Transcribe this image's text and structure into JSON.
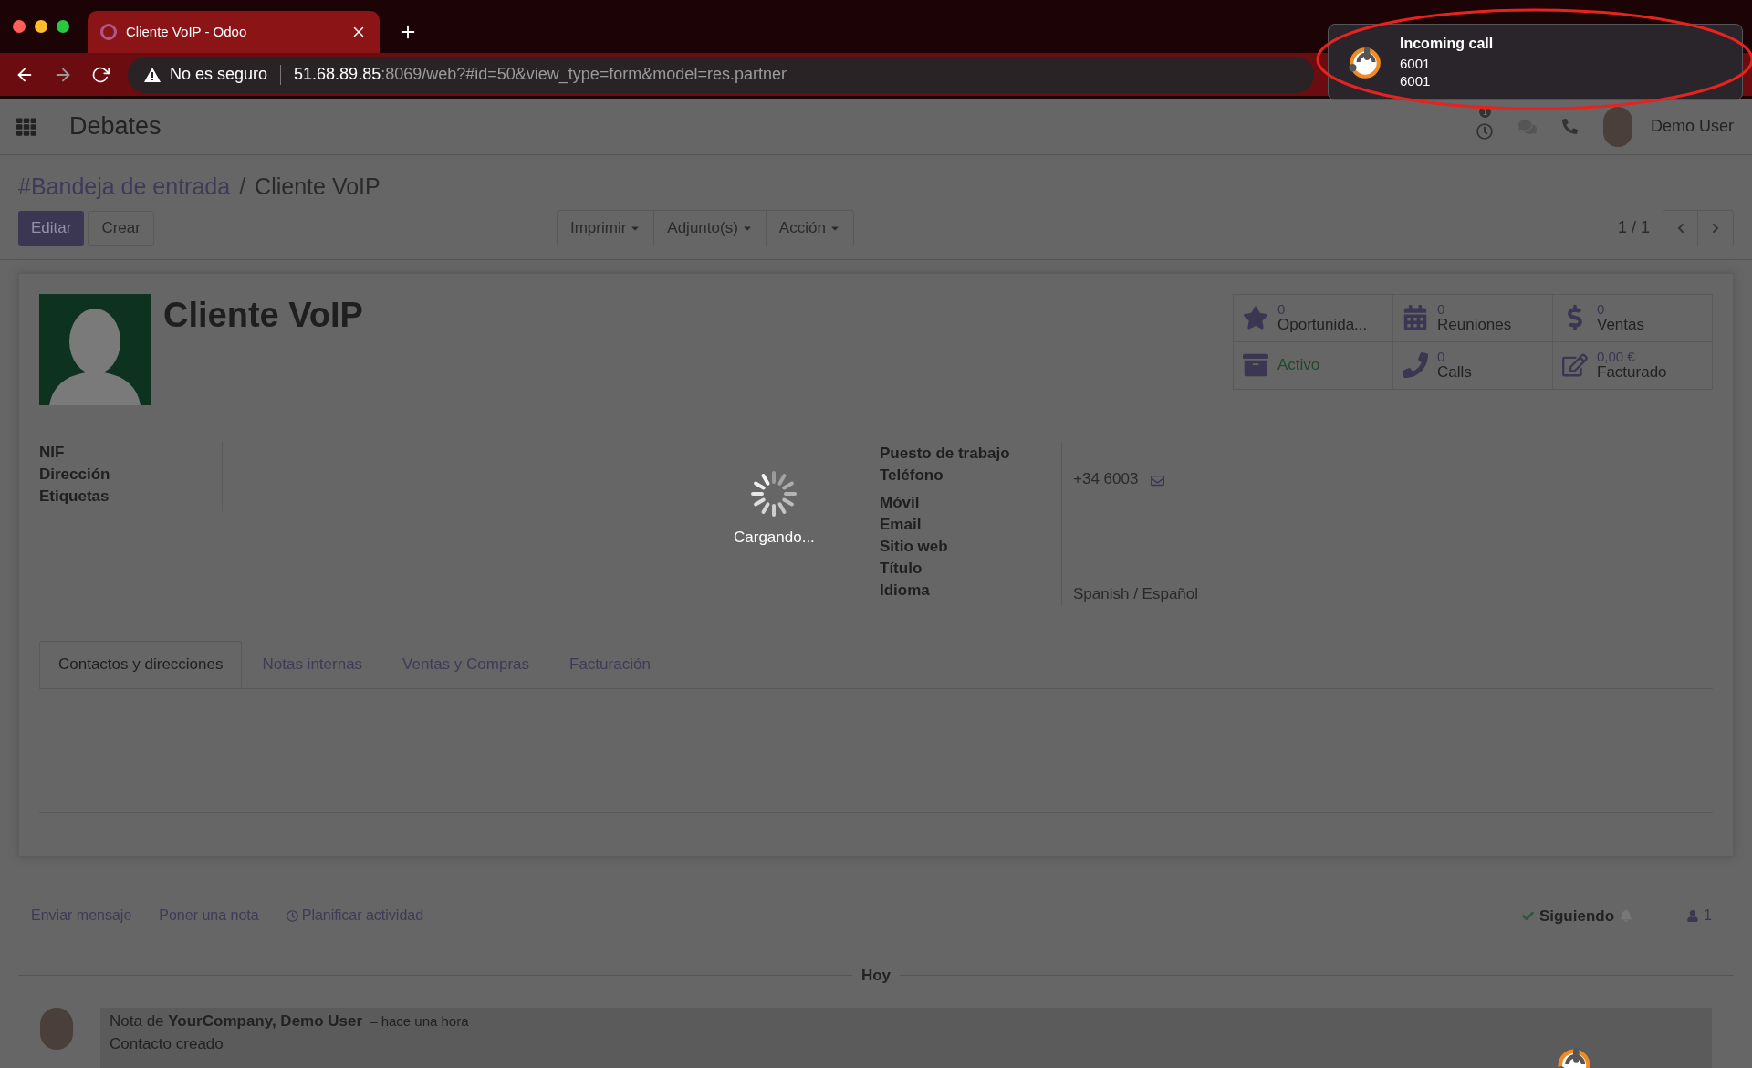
{
  "browser": {
    "tab_title": "Cliente VoIP - Odoo",
    "warning": "No es seguro",
    "host": "51.68.89.85",
    "path": ":8069/web?#id=50&view_type=form&model=res.partner"
  },
  "notification": {
    "title": "Incoming call",
    "lines": [
      "6001",
      "6001"
    ]
  },
  "navbar": {
    "app": "Debates",
    "activity_count": "1",
    "user": "Demo User"
  },
  "breadcrumb": [
    {
      "label": "#Bandeja de entrada",
      "link": true
    },
    {
      "label": "Cliente VoIP",
      "link": false
    }
  ],
  "breadcrumb_separator": "/",
  "actions": [
    {
      "label": "Editar",
      "primary": true
    },
    {
      "label": "Crear",
      "primary": false
    }
  ],
  "dropdowns": [
    "Imprimir",
    "Adjunto(s)",
    "Acción"
  ],
  "pager": "1 / 1",
  "form": {
    "title": "Cliente VoIP",
    "smart_buttons": [
      {
        "kind": "stat",
        "value": "0",
        "label": "Oportunida..."
      },
      {
        "kind": "stat",
        "value": "0",
        "label": "Reuniones"
      },
      {
        "kind": "stat",
        "value": "0",
        "label": "Ventas"
      },
      {
        "kind": "toggle",
        "label": "Activo"
      },
      {
        "kind": "stat",
        "value": "0",
        "label": "Calls"
      },
      {
        "kind": "stat",
        "value": "0,00 €",
        "label": "Facturado"
      }
    ],
    "left_fields": [
      {
        "label": "NIF"
      },
      {
        "label": "Dirección"
      },
      {
        "label": "Etiquetas"
      }
    ],
    "right_fields": [
      {
        "label": "Puesto de trabajo"
      },
      {
        "label": "Teléfono",
        "value": "+34 6003"
      },
      {
        "label": "Móvil"
      },
      {
        "label": "Email"
      },
      {
        "label": "Sitio web"
      },
      {
        "label": "Título"
      },
      {
        "label": "Idioma",
        "value": "Spanish / Español"
      }
    ],
    "tabs": [
      {
        "label": "Contactos y direcciones",
        "selected": true
      },
      {
        "label": "Notas internas",
        "selected": false
      },
      {
        "label": "Ventas y Compras",
        "selected": false
      },
      {
        "label": "Facturación",
        "selected": false
      }
    ]
  },
  "loading": "Cargando...",
  "chatter": {
    "actions": [
      {
        "label": "Enviar mensaje",
        "kind": "plain"
      },
      {
        "label": "Poner una nota",
        "kind": "plain"
      },
      {
        "label": "Planificar actividad",
        "kind": "clock"
      }
    ],
    "follow": "Siguiendo",
    "followers": "1",
    "date": "Hoy",
    "message": {
      "header": "Nota de **YourCompany, Demo User**",
      "time": "– hace una hora",
      "body": "Contacto creado"
    }
  }
}
